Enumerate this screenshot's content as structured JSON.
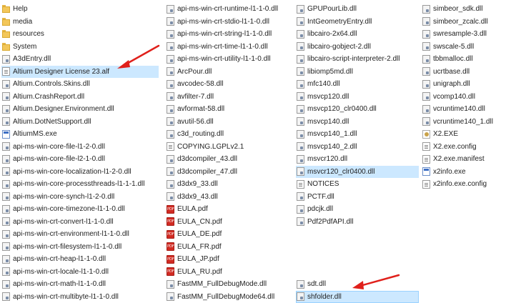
{
  "colors": {
    "selection": "#cce8ff",
    "arrow": "#e0201b",
    "folder": "#f3c75a"
  },
  "columns": [
    [
      {
        "name": "Help",
        "icon": "folder-icon"
      },
      {
        "name": "media",
        "icon": "folder-icon"
      },
      {
        "name": "resources",
        "icon": "folder-icon"
      },
      {
        "name": "System",
        "icon": "folder-icon"
      },
      {
        "name": "A3dEntry.dll",
        "icon": "dll-file-icon"
      },
      {
        "name": "Altium Designer License 23.alf",
        "icon": "document-icon",
        "selected": true
      },
      {
        "name": "Altium.Controls.Skins.dll",
        "icon": "dll-file-icon"
      },
      {
        "name": "Altium.CrashReport.dll",
        "icon": "dll-file-icon"
      },
      {
        "name": "Altium.Designer.Environment.dll",
        "icon": "dll-file-icon"
      },
      {
        "name": "Altium.DotNetSupport.dll",
        "icon": "dll-file-icon"
      },
      {
        "name": "AltiumMS.exe",
        "icon": "exe-file-icon"
      },
      {
        "name": "api-ms-win-core-file-l1-2-0.dll",
        "icon": "dll-file-icon"
      },
      {
        "name": "api-ms-win-core-file-l2-1-0.dll",
        "icon": "dll-file-icon"
      },
      {
        "name": "api-ms-win-core-localization-l1-2-0.dll",
        "icon": "dll-file-icon"
      },
      {
        "name": "api-ms-win-core-processthreads-l1-1-1.dll",
        "icon": "dll-file-icon"
      },
      {
        "name": "api-ms-win-core-synch-l1-2-0.dll",
        "icon": "dll-file-icon"
      },
      {
        "name": "api-ms-win-core-timezone-l1-1-0.dll",
        "icon": "dll-file-icon"
      },
      {
        "name": "api-ms-win-crt-convert-l1-1-0.dll",
        "icon": "dll-file-icon"
      },
      {
        "name": "api-ms-win-crt-environment-l1-1-0.dll",
        "icon": "dll-file-icon"
      },
      {
        "name": "api-ms-win-crt-filesystem-l1-1-0.dll",
        "icon": "dll-file-icon"
      },
      {
        "name": "api-ms-win-crt-heap-l1-1-0.dll",
        "icon": "dll-file-icon"
      },
      {
        "name": "api-ms-win-crt-locale-l1-1-0.dll",
        "icon": "dll-file-icon"
      },
      {
        "name": "api-ms-win-crt-math-l1-1-0.dll",
        "icon": "dll-file-icon"
      },
      {
        "name": "api-ms-win-crt-multibyte-l1-1-0.dll",
        "icon": "dll-file-icon"
      }
    ],
    [
      {
        "name": "api-ms-win-crt-runtime-l1-1-0.dll",
        "icon": "dll-file-icon"
      },
      {
        "name": "api-ms-win-crt-stdio-l1-1-0.dll",
        "icon": "dll-file-icon"
      },
      {
        "name": "api-ms-win-crt-string-l1-1-0.dll",
        "icon": "dll-file-icon"
      },
      {
        "name": "api-ms-win-crt-time-l1-1-0.dll",
        "icon": "dll-file-icon"
      },
      {
        "name": "api-ms-win-crt-utility-l1-1-0.dll",
        "icon": "dll-file-icon"
      },
      {
        "name": "ArcPour.dll",
        "icon": "dll-file-icon"
      },
      {
        "name": "avcodec-58.dll",
        "icon": "dll-file-icon"
      },
      {
        "name": "avfilter-7.dll",
        "icon": "dll-file-icon"
      },
      {
        "name": "avformat-58.dll",
        "icon": "dll-file-icon"
      },
      {
        "name": "avutil-56.dll",
        "icon": "dll-file-icon"
      },
      {
        "name": "c3d_routing.dll",
        "icon": "dll-file-icon"
      },
      {
        "name": "COPYING.LGPLv2.1",
        "icon": "document-icon"
      },
      {
        "name": "d3dcompiler_43.dll",
        "icon": "dll-file-icon"
      },
      {
        "name": "d3dcompiler_47.dll",
        "icon": "dll-file-icon"
      },
      {
        "name": "d3dx9_33.dll",
        "icon": "dll-file-icon"
      },
      {
        "name": "d3dx9_43.dll",
        "icon": "dll-file-icon"
      },
      {
        "name": "EULA.pdf",
        "icon": "pdf-file-icon"
      },
      {
        "name": "EULA_CN.pdf",
        "icon": "pdf-file-icon"
      },
      {
        "name": "EULA_DE.pdf",
        "icon": "pdf-file-icon"
      },
      {
        "name": "EULA_FR.pdf",
        "icon": "pdf-file-icon"
      },
      {
        "name": "EULA_JP.pdf",
        "icon": "pdf-file-icon"
      },
      {
        "name": "EULA_RU.pdf",
        "icon": "pdf-file-icon"
      },
      {
        "name": "FastMM_FullDebugMode.dll",
        "icon": "dll-file-icon"
      },
      {
        "name": "FastMM_FullDebugMode64.dll",
        "icon": "dll-file-icon"
      }
    ],
    [
      {
        "name": "GPUPourLib.dll",
        "icon": "dll-file-icon"
      },
      {
        "name": "IntGeometryEntry.dll",
        "icon": "dll-file-icon"
      },
      {
        "name": "libcairo-2x64.dll",
        "icon": "dll-file-icon"
      },
      {
        "name": "libcairo-gobject-2.dll",
        "icon": "dll-file-icon"
      },
      {
        "name": "libcairo-script-interpreter-2.dll",
        "icon": "dll-file-icon"
      },
      {
        "name": "libiomp5md.dll",
        "icon": "dll-file-icon"
      },
      {
        "name": "mfc140.dll",
        "icon": "dll-file-icon"
      },
      {
        "name": "msvcp120.dll",
        "icon": "dll-file-icon"
      },
      {
        "name": "msvcp120_clr0400.dll",
        "icon": "dll-file-icon"
      },
      {
        "name": "msvcp140.dll",
        "icon": "dll-file-icon"
      },
      {
        "name": "msvcp140_1.dll",
        "icon": "dll-file-icon"
      },
      {
        "name": "msvcp140_2.dll",
        "icon": "dll-file-icon"
      },
      {
        "name": "msvcr120.dll",
        "icon": "dll-file-icon"
      },
      {
        "name": "msvcr120_clr0400.dll",
        "icon": "dll-file-icon",
        "selected": true
      },
      {
        "name": "NOTICES",
        "icon": "document-icon"
      },
      {
        "name": "PCTF.dll",
        "icon": "dll-file-icon"
      },
      {
        "name": "pdcjk.dll",
        "icon": "dll-file-icon"
      },
      {
        "name": "Pdf2PdfAPI.dll",
        "icon": "dll-file-icon"
      },
      {
        "name": "",
        "icon": ""
      },
      {
        "name": "",
        "icon": ""
      },
      {
        "name": "",
        "icon": ""
      },
      {
        "name": "",
        "icon": ""
      },
      {
        "name": "sdt.dll",
        "icon": "dll-file-icon"
      },
      {
        "name": "shfolder.dll",
        "icon": "dll-file-icon",
        "selected": true,
        "bordered": true
      }
    ],
    [
      {
        "name": "simbeor_sdk.dll",
        "icon": "dll-file-icon"
      },
      {
        "name": "simbeor_zcalc.dll",
        "icon": "dll-file-icon"
      },
      {
        "name": "swresample-3.dll",
        "icon": "dll-file-icon"
      },
      {
        "name": "swscale-5.dll",
        "icon": "dll-file-icon"
      },
      {
        "name": "tbbmalloc.dll",
        "icon": "dll-file-icon"
      },
      {
        "name": "ucrtbase.dll",
        "icon": "dll-file-icon"
      },
      {
        "name": "unigraph.dll",
        "icon": "dll-file-icon"
      },
      {
        "name": "vcomp140.dll",
        "icon": "dll-file-icon"
      },
      {
        "name": "vcruntime140.dll",
        "icon": "dll-file-icon"
      },
      {
        "name": "vcruntime140_1.dll",
        "icon": "dll-file-icon"
      },
      {
        "name": "X2.EXE",
        "icon": "x2-app-icon"
      },
      {
        "name": "X2.exe.config",
        "icon": "document-icon"
      },
      {
        "name": "X2.exe.manifest",
        "icon": "document-icon"
      },
      {
        "name": "x2info.exe",
        "icon": "exe-file-icon"
      },
      {
        "name": "x2info.exe.config",
        "icon": "document-icon"
      }
    ]
  ]
}
